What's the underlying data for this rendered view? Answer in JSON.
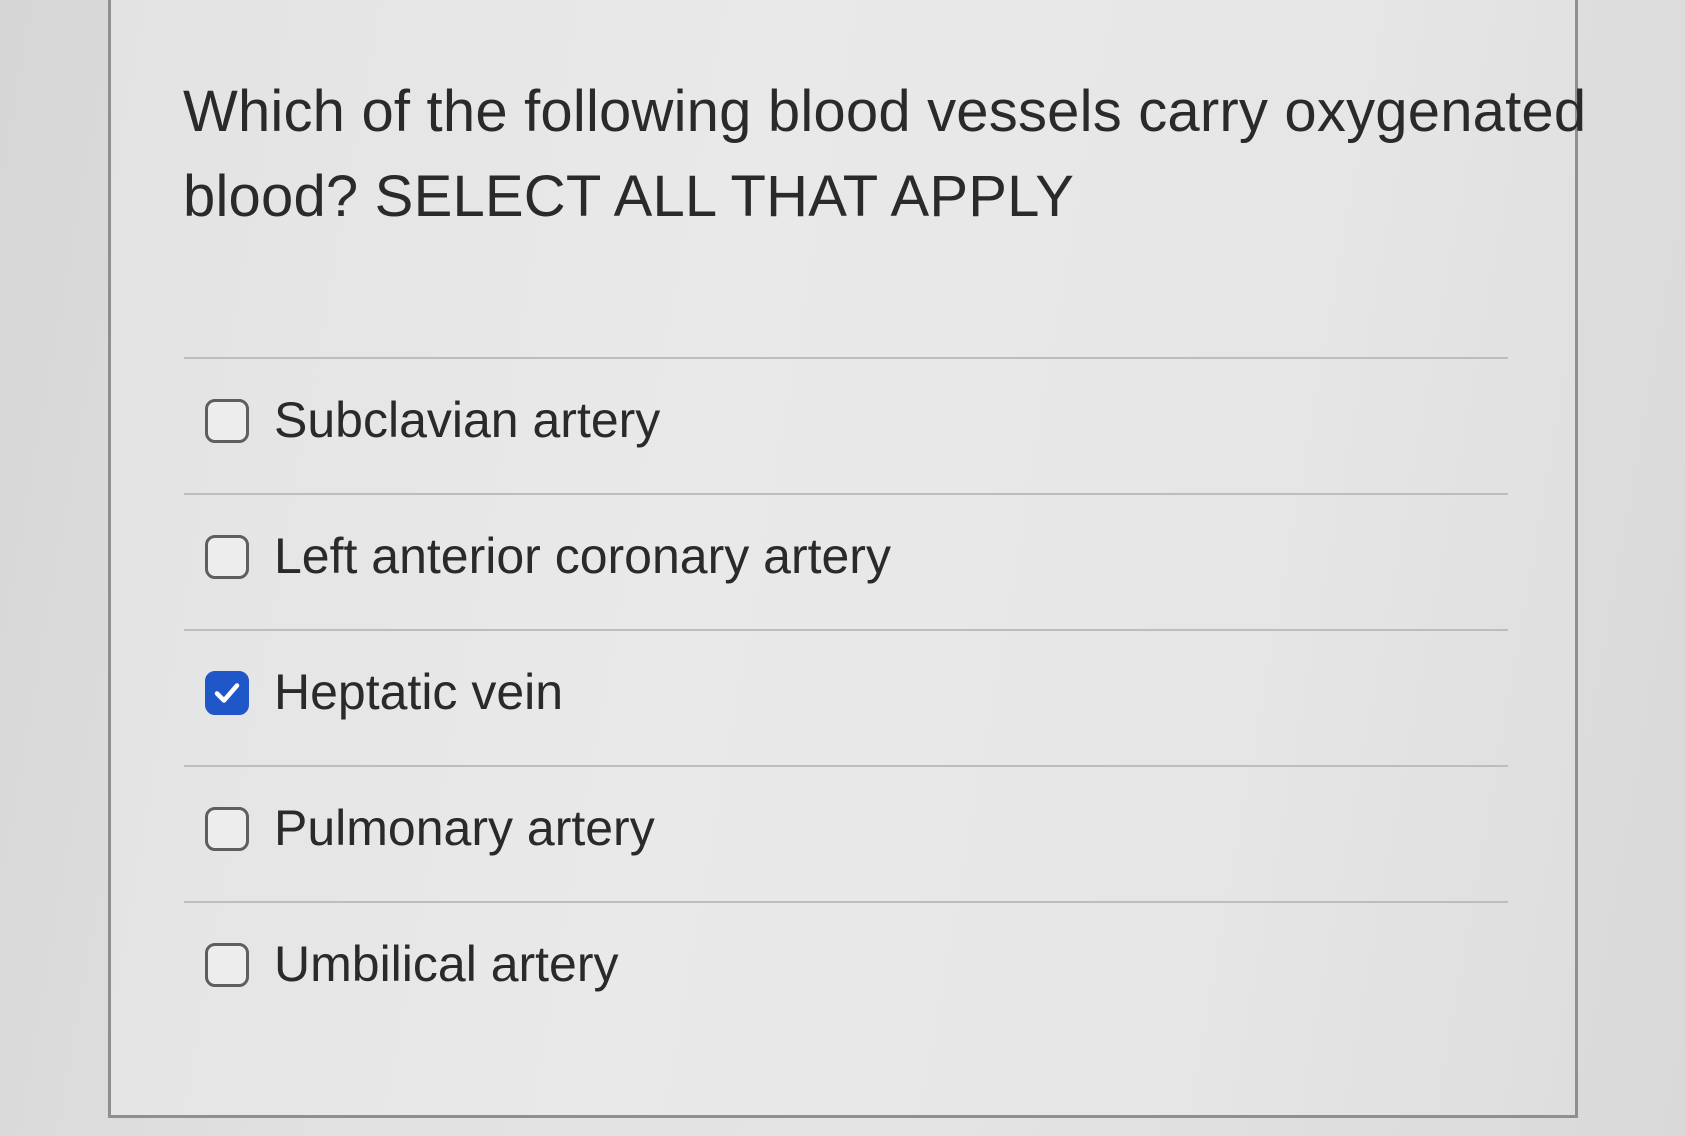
{
  "question": {
    "text": "Which of the following blood vessels carry oxygenated blood? SELECT ALL THAT APPLY"
  },
  "options": [
    {
      "label": "Subclavian artery",
      "checked": false
    },
    {
      "label": "Left anterior coronary artery",
      "checked": false
    },
    {
      "label": "Heptatic vein",
      "checked": true
    },
    {
      "label": "Pulmonary artery",
      "checked": false
    },
    {
      "label": "Umbilical artery",
      "checked": false
    }
  ],
  "colors": {
    "checkbox_checked": "#1f57c8",
    "checkbox_unchecked_border": "#5e5e5e",
    "text": "#2a2a2a"
  },
  "icons": {
    "checked": "checkmark-icon"
  }
}
